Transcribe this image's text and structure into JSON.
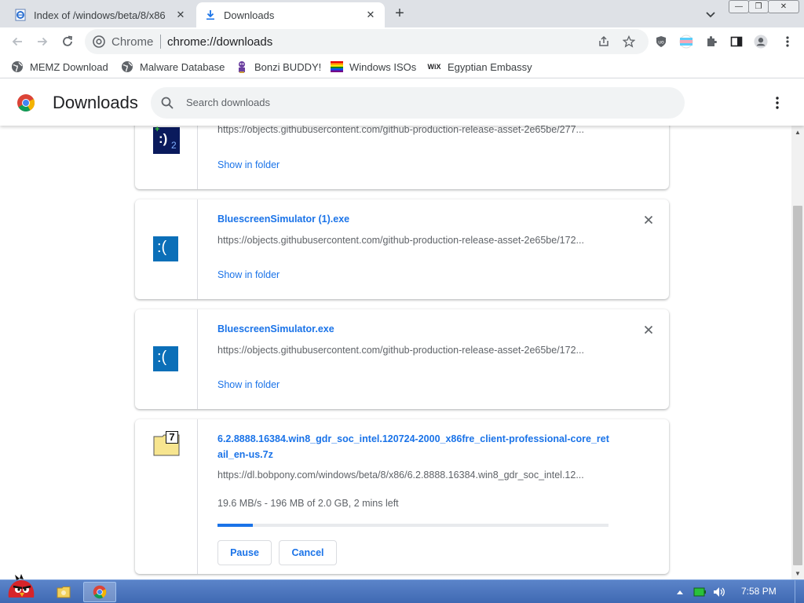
{
  "tabs": [
    {
      "title": "Index of /windows/beta/8/x86",
      "active": false
    },
    {
      "title": "Downloads",
      "active": true
    }
  ],
  "window_controls": {
    "minimize": "—",
    "maximize": "❐",
    "close": "✕"
  },
  "omnibox": {
    "label": "Chrome",
    "url": "chrome://downloads"
  },
  "bookmarks": [
    {
      "label": "MEMZ Download",
      "icon": "globe-icon"
    },
    {
      "label": "Malware Database",
      "icon": "globe-icon"
    },
    {
      "label": "Bonzi BUDDY!",
      "icon": "bonzi-icon"
    },
    {
      "label": "Windows ISOs",
      "icon": "rainbow-flag-icon"
    },
    {
      "label": "Egyptian Embassy",
      "icon": "wix-icon"
    }
  ],
  "wix_text": "WiX",
  "header": {
    "title": "Downloads",
    "search_placeholder": "Search downloads"
  },
  "downloads": [
    {
      "url": "https://objects.githubusercontent.com/github-production-release-asset-2e65be/277...",
      "show_in_folder": "Show in folder",
      "icon_text": ":)",
      "icon_sub": "2",
      "icon_plus": "+"
    },
    {
      "name": "BluescreenSimulator (1).exe",
      "url": "https://objects.githubusercontent.com/github-production-release-asset-2e65be/172...",
      "show_in_folder": "Show in folder",
      "icon_text": ":("
    },
    {
      "name": "BluescreenSimulator.exe",
      "url": "https://objects.githubusercontent.com/github-production-release-asset-2e65be/172...",
      "show_in_folder": "Show in folder",
      "icon_text": ":("
    },
    {
      "name": "6.2.8888.16384.win8_gdr_soc_intel.120724-2000_x86fre_client-professional-core_retail_en-us.7z",
      "url": "https://dl.bobpony.com/windows/beta/8/x86/6.2.8888.16384.win8_gdr_soc_intel.12...",
      "status": "19.6 MB/s - 196 MB of 2.0 GB, 2 mins left",
      "progress": 0.09,
      "pause_label": "Pause",
      "cancel_label": "Cancel",
      "icon_text": "7"
    }
  ],
  "taskbar": {
    "clock": "7:58 PM"
  },
  "colors": {
    "accent": "#1a73e8",
    "bsod_blue": "#0b6fb8",
    "taskbar": "#4a74bd"
  }
}
